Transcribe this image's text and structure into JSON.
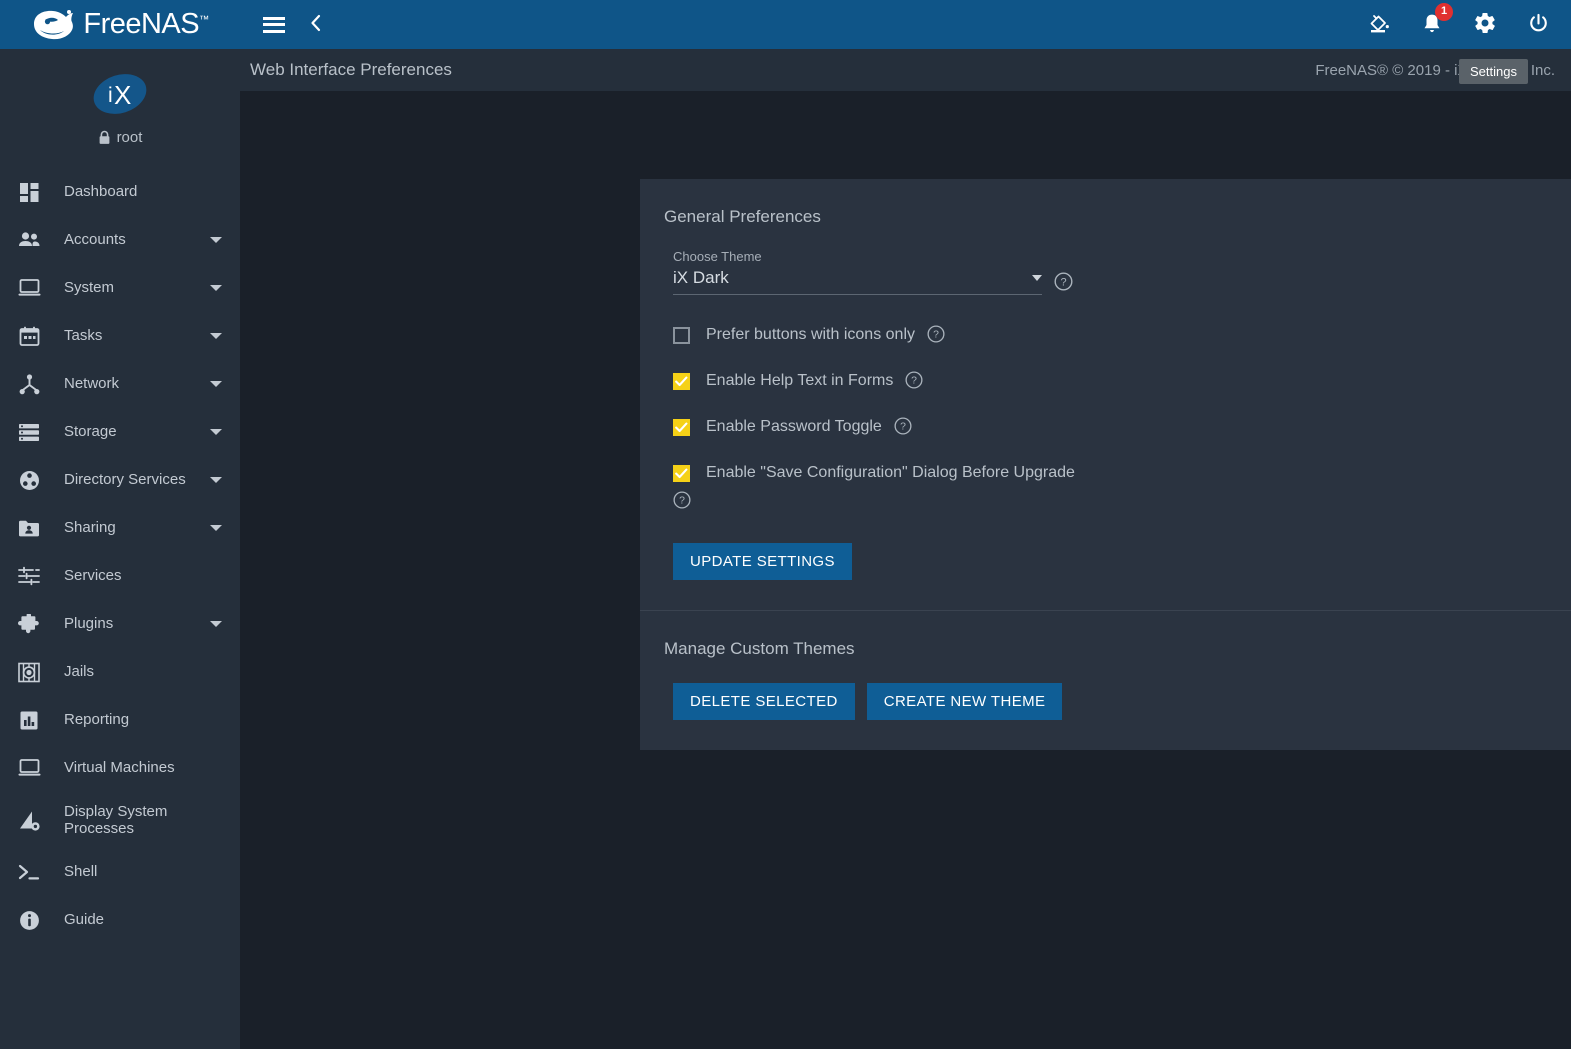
{
  "brand": {
    "name": "FreeNAS",
    "tm": "™",
    "logo_icon": "freenas-fish-logo"
  },
  "topbar": {
    "menu_icon": "hamburger-menu-icon",
    "back_icon": "chevron-left-icon",
    "theme_icon": "paint-bucket-icon",
    "notifications_icon": "bell-icon",
    "notifications_count": "1",
    "settings_icon": "gear-icon",
    "power_icon": "power-icon"
  },
  "tooltip": {
    "text": "Settings"
  },
  "sidebar": {
    "user": {
      "name": "root",
      "lock_icon": "lock-icon",
      "avatar_text": "iX"
    },
    "items": [
      {
        "label": "Dashboard",
        "icon": "dashboard-icon",
        "expandable": false
      },
      {
        "label": "Accounts",
        "icon": "accounts-icon",
        "expandable": true
      },
      {
        "label": "System",
        "icon": "system-icon",
        "expandable": true
      },
      {
        "label": "Tasks",
        "icon": "tasks-calendar-icon",
        "expandable": true
      },
      {
        "label": "Network",
        "icon": "network-icon",
        "expandable": true
      },
      {
        "label": "Storage",
        "icon": "storage-icon",
        "expandable": true
      },
      {
        "label": "Directory Services",
        "icon": "directory-services-icon",
        "expandable": true
      },
      {
        "label": "Sharing",
        "icon": "sharing-folder-icon",
        "expandable": true
      },
      {
        "label": "Services",
        "icon": "services-sliders-icon",
        "expandable": false
      },
      {
        "label": "Plugins",
        "icon": "plugins-puzzle-icon",
        "expandable": true
      },
      {
        "label": "Jails",
        "icon": "jails-icon",
        "expandable": false
      },
      {
        "label": "Reporting",
        "icon": "reporting-chart-icon",
        "expandable": false
      },
      {
        "label": "Virtual Machines",
        "icon": "virtual-machines-icon",
        "expandable": false
      },
      {
        "label": "Display System Processes",
        "icon": "display-system-processes-icon",
        "expandable": false
      },
      {
        "label": "Shell",
        "icon": "shell-prompt-icon",
        "expandable": false
      },
      {
        "label": "Guide",
        "icon": "guide-info-icon",
        "expandable": false
      }
    ]
  },
  "page": {
    "title": "Web Interface Preferences",
    "copyright": "FreeNAS® © 2019 - iXsystems, Inc."
  },
  "general_preferences": {
    "title": "General Preferences",
    "theme_field": {
      "label": "Choose Theme",
      "value": "iX Dark",
      "dropdown_icon": "chevron-down-icon",
      "help_icon": "help-circle-icon"
    },
    "checkboxes": [
      {
        "label": "Prefer buttons with icons only",
        "checked": false,
        "help_icon": "help-circle-icon"
      },
      {
        "label": "Enable Help Text in Forms",
        "checked": true,
        "help_icon": "help-circle-icon"
      },
      {
        "label": "Enable Password Toggle",
        "checked": true,
        "help_icon": "help-circle-icon"
      },
      {
        "label": "Enable \"Save Configuration\" Dialog Before Upgrade",
        "checked": true,
        "help_icon": "help-circle-icon"
      }
    ],
    "update_button": "UPDATE SETTINGS"
  },
  "manage_custom_themes": {
    "title": "Manage Custom Themes",
    "delete_button": "DELETE SELECTED",
    "create_button": "CREATE NEW THEME"
  },
  "colors": {
    "header_blue": "#0f5588",
    "button_blue": "#0f5e96",
    "sidebar_bg": "#252f3b",
    "card_bg": "#2a3340",
    "page_bg": "#1a2029",
    "checkbox_checked": "#f5d117",
    "badge_red": "#e03030",
    "text_primary": "#b9c1c9"
  }
}
